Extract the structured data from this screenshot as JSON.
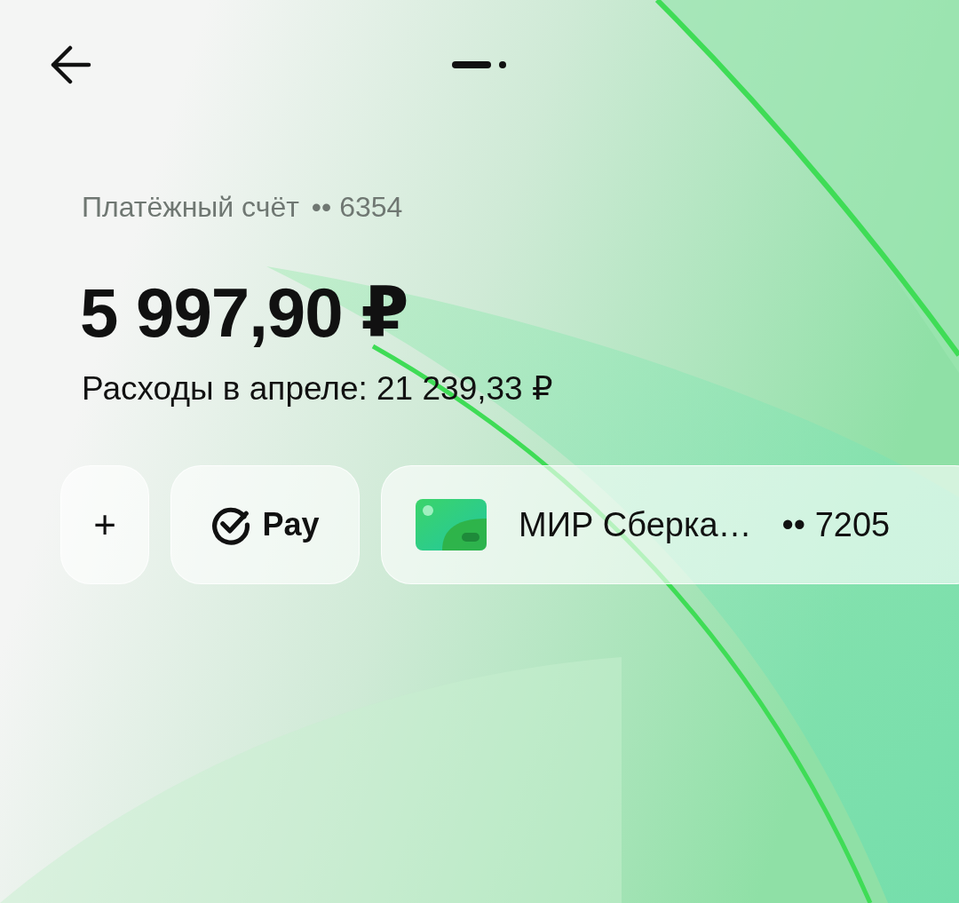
{
  "account": {
    "label": "Платёжный счёт",
    "number": "•• 6354"
  },
  "balance": "5 997,90 ₽",
  "spending": "Расходы в апреле: 21 239,33 ₽",
  "actions": [
    {
      "kind": "add",
      "label": "+"
    },
    {
      "kind": "pay",
      "label": "Pay"
    }
  ],
  "card": {
    "name": "МИР Сберка…",
    "number": "•• 7205"
  }
}
